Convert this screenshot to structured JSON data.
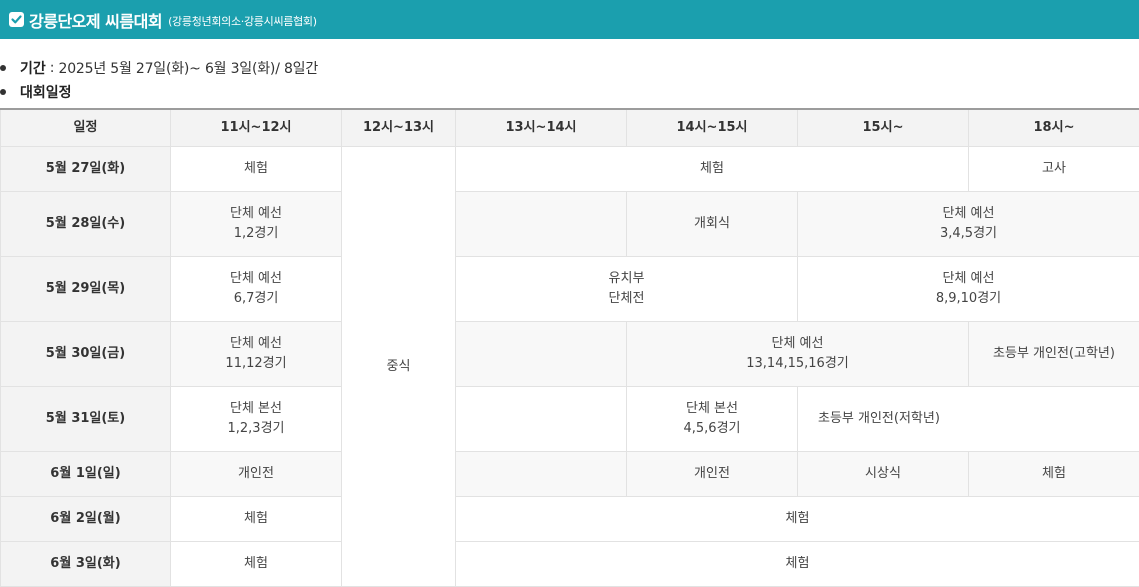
{
  "header": {
    "title": "강릉단오제 씨름대회",
    "subtitle": "(강릉청년회의소·강릉시씨름협회)",
    "accent_color": "#1b9fae",
    "icon": "checkbox-checked-icon"
  },
  "info": {
    "period_label": "기간",
    "period_separator": ":",
    "period_value": "2025년 5월 27일(화)~ 6월 3일(화)/ 8일간",
    "schedule_label": "대회일정"
  },
  "table": {
    "headers": [
      "일정",
      "11시~12시",
      "12시~13시",
      "13시~14시",
      "14시~15시",
      "15시~",
      "18시~"
    ],
    "lunch": "중식",
    "rows": [
      {
        "date": "5월 27일(화)",
        "c11": "체험",
        "afternoon_main": "체험",
        "c18": "고사"
      },
      {
        "date": "5월 28일(수)",
        "c11_line1": "단체 예선",
        "c11_line2": "1,2경기",
        "c13": "",
        "c14": "개회식",
        "c15_line1": "단체 예선",
        "c15_line2": "3,4,5경기"
      },
      {
        "date": "5월 29일(목)",
        "c11_line1": "단체 예선",
        "c11_line2": "6,7경기",
        "c13_line1": "유치부",
        "c13_line2": "단체전",
        "c15_line1": "단체 예선",
        "c15_line2": "8,9,10경기"
      },
      {
        "date": "5월 30일(금)",
        "c11_line1": "단체 예선",
        "c11_line2": "11,12경기",
        "c13": "",
        "c14_line1": "단체 예선",
        "c14_line2": "13,14,15,16경기",
        "c18": "초등부 개인전(고학년)"
      },
      {
        "date": "5월 31일(토)",
        "c11_line1": "단체 본선",
        "c11_line2": "1,2,3경기",
        "c13": "",
        "c14_line1": "단체 본선",
        "c14_line2": "4,5,6경기",
        "c15": "초등부 개인전(저학년)"
      },
      {
        "date": "6월 1일(일)",
        "c11": "개인전",
        "c13": "",
        "c14": "개인전",
        "c15": "시상식",
        "c18": "체험"
      },
      {
        "date": "6월 2일(월)",
        "c11": "체험",
        "afternoon": "체험"
      },
      {
        "date": "6월 3일(화)",
        "c11": "체험",
        "afternoon": "체험"
      }
    ]
  }
}
